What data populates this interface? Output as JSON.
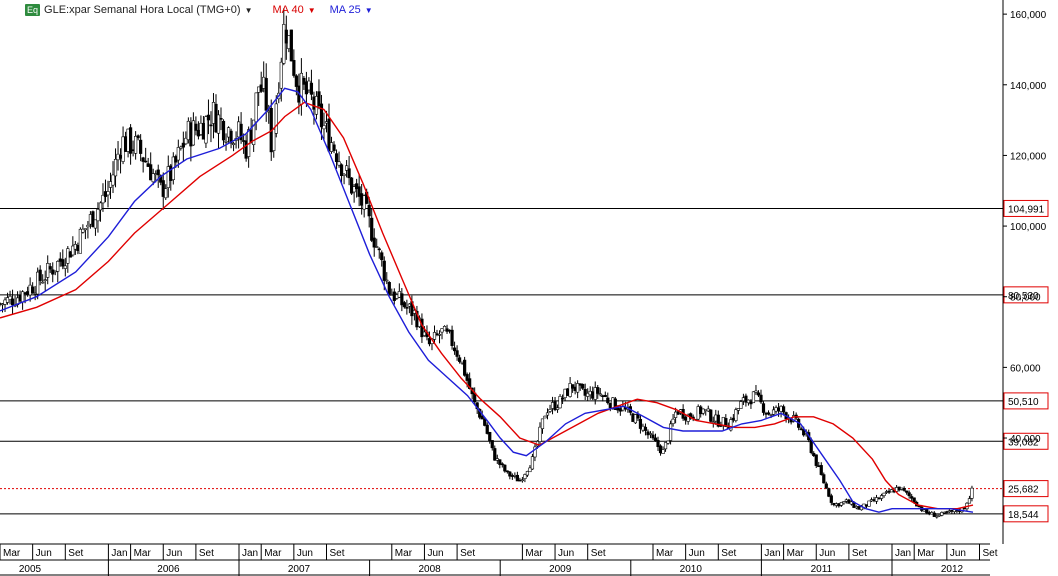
{
  "header": {
    "badge": "Eq",
    "symbol_label": "GLE:xpar Semanal Hora Local (TMG+0)",
    "ma40_label": "MA 40",
    "ma25_label": "MA 25",
    "dropdown_glyph": "▼"
  },
  "colors": {
    "price": "#000000",
    "ma40": "#e00000",
    "ma25": "#1e1ed8",
    "level_box": "#e00000",
    "badge": "#2e8b3e"
  },
  "chart_data": {
    "type": "line",
    "chart_style": "candlestick",
    "title": "GLE:xpar Semanal Hora Local (TMG+0)",
    "ylim": [
      10,
      164
    ],
    "y_ticks": [
      {
        "value": 160,
        "label": "160,000"
      },
      {
        "value": 140,
        "label": "140,000"
      },
      {
        "value": 120,
        "label": "120,000"
      },
      {
        "value": 100,
        "label": "100,000"
      },
      {
        "value": 80,
        "label": "80,000"
      },
      {
        "value": 60,
        "label": "60,000"
      },
      {
        "value": 40,
        "label": "40,000"
      }
    ],
    "x_range": [
      2005.17,
      2012.85
    ],
    "month_labels": [
      {
        "t": 2005.17,
        "label": "Mar"
      },
      {
        "t": 2005.42,
        "label": "Jun"
      },
      {
        "t": 2005.67,
        "label": "Set"
      },
      {
        "t": 2006.0,
        "label": "Jan"
      },
      {
        "t": 2006.17,
        "label": "Mar"
      },
      {
        "t": 2006.42,
        "label": "Jun"
      },
      {
        "t": 2006.67,
        "label": "Set"
      },
      {
        "t": 2007.0,
        "label": "Jan"
      },
      {
        "t": 2007.17,
        "label": "Mar"
      },
      {
        "t": 2007.42,
        "label": "Jun"
      },
      {
        "t": 2007.67,
        "label": "Set"
      },
      {
        "t": 2008.17,
        "label": "Mar"
      },
      {
        "t": 2008.42,
        "label": "Jun"
      },
      {
        "t": 2008.67,
        "label": "Set"
      },
      {
        "t": 2009.17,
        "label": "Mar"
      },
      {
        "t": 2009.42,
        "label": "Jun"
      },
      {
        "t": 2009.67,
        "label": "Set"
      },
      {
        "t": 2010.17,
        "label": "Mar"
      },
      {
        "t": 2010.42,
        "label": "Jun"
      },
      {
        "t": 2010.67,
        "label": "Set"
      },
      {
        "t": 2011.0,
        "label": "Jan"
      },
      {
        "t": 2011.17,
        "label": "Mar"
      },
      {
        "t": 2011.42,
        "label": "Jun"
      },
      {
        "t": 2011.67,
        "label": "Set"
      },
      {
        "t": 2012.0,
        "label": "Jan"
      },
      {
        "t": 2012.17,
        "label": "Mar"
      },
      {
        "t": 2012.42,
        "label": "Jun"
      },
      {
        "t": 2012.67,
        "label": "Set"
      }
    ],
    "year_labels": [
      {
        "t": 2005.2,
        "label": "2005"
      },
      {
        "t": 2006.0,
        "label": "2006"
      },
      {
        "t": 2007.0,
        "label": "2007"
      },
      {
        "t": 2008.0,
        "label": "2008"
      },
      {
        "t": 2009.0,
        "label": "2009"
      },
      {
        "t": 2010.0,
        "label": "2010"
      },
      {
        "t": 2011.0,
        "label": "2011"
      },
      {
        "t": 2012.0,
        "label": "2012"
      }
    ],
    "levels": [
      {
        "value": 104.991,
        "label": "104,991",
        "style": "solid"
      },
      {
        "value": 80.53,
        "label": "80,530",
        "style": "solid"
      },
      {
        "value": 50.51,
        "label": "50,510",
        "style": "solid"
      },
      {
        "value": 39.082,
        "label": "39,082",
        "style": "solid"
      },
      {
        "value": 25.682,
        "label": "25,682",
        "style": "dotted",
        "color": "#e00000"
      },
      {
        "value": 18.544,
        "label": "18,544",
        "style": "solid"
      }
    ],
    "series": [
      {
        "name": "GLE:xpar",
        "t": [
          2005.17,
          2005.3,
          2005.45,
          2005.6,
          2005.75,
          2005.9,
          2006.0,
          2006.1,
          2006.2,
          2006.3,
          2006.4,
          2006.5,
          2006.6,
          2006.7,
          2006.8,
          2006.9,
          2007.0,
          2007.05,
          2007.1,
          2007.15,
          2007.2,
          2007.25,
          2007.3,
          2007.35,
          2007.45,
          2007.55,
          2007.65,
          2007.75,
          2007.85,
          2007.95,
          2008.05,
          2008.15,
          2008.25,
          2008.35,
          2008.45,
          2008.55,
          2008.62,
          2008.7,
          2008.8,
          2008.88,
          2008.95,
          2009.05,
          2009.15,
          2009.25,
          2009.35,
          2009.45,
          2009.55,
          2009.65,
          2009.75,
          2009.85,
          2009.95,
          2010.05,
          2010.15,
          2010.25,
          2010.35,
          2010.45,
          2010.55,
          2010.65,
          2010.75,
          2010.85,
          2010.95,
          2011.05,
          2011.15,
          2011.25,
          2011.35,
          2011.45,
          2011.55,
          2011.65,
          2011.75,
          2011.85,
          2011.95,
          2012.05,
          2012.15,
          2012.25,
          2012.35,
          2012.45,
          2012.55,
          2012.62
        ],
        "values": [
          78,
          80,
          84,
          89,
          95,
          104,
          110,
          124,
          123,
          118,
          110,
          116,
          126,
          128,
          132,
          128,
          126,
          122,
          128,
          140,
          137,
          123,
          141,
          158,
          140,
          136,
          128,
          121,
          112,
          106,
          95,
          82,
          78,
          75,
          66,
          70,
          68,
          62,
          50,
          44,
          35,
          30,
          28,
          34,
          48,
          50,
          55,
          52,
          53,
          50,
          48,
          45,
          40,
          36,
          48,
          46,
          48,
          45,
          44,
          50,
          52,
          47,
          48,
          45,
          40,
          30,
          21,
          22,
          20,
          22,
          24,
          26,
          23,
          19,
          18,
          19,
          20,
          25.7
        ]
      },
      {
        "name": "MA 40",
        "t": [
          2005.17,
          2005.45,
          2005.75,
          2006.0,
          2006.2,
          2006.45,
          2006.7,
          2006.95,
          2007.1,
          2007.25,
          2007.35,
          2007.5,
          2007.65,
          2007.8,
          2007.95,
          2008.1,
          2008.25,
          2008.4,
          2008.55,
          2008.7,
          2008.85,
          2009.0,
          2009.15,
          2009.3,
          2009.45,
          2009.6,
          2009.75,
          2009.9,
          2010.05,
          2010.2,
          2010.35,
          2010.5,
          2010.65,
          2010.8,
          2010.95,
          2011.1,
          2011.25,
          2011.4,
          2011.55,
          2011.7,
          2011.85,
          2011.95,
          2012.05,
          2012.2,
          2012.35,
          2012.5,
          2012.62
        ],
        "values": [
          74,
          77,
          82,
          90,
          98,
          106,
          114,
          120,
          124,
          127,
          131,
          135,
          133,
          125,
          112,
          98,
          85,
          72,
          64,
          57,
          51,
          46,
          40,
          38,
          41,
          44,
          47,
          49,
          51,
          50,
          48,
          45,
          44,
          43,
          43,
          44,
          46,
          46,
          44,
          40,
          34,
          28,
          24,
          21,
          20,
          20,
          21
        ]
      },
      {
        "name": "MA 25",
        "t": [
          2005.17,
          2005.45,
          2005.75,
          2006.0,
          2006.2,
          2006.4,
          2006.6,
          2006.85,
          2007.05,
          2007.2,
          2007.35,
          2007.45,
          2007.55,
          2007.7,
          2007.85,
          2008.0,
          2008.15,
          2008.3,
          2008.45,
          2008.6,
          2008.75,
          2008.9,
          2009.0,
          2009.1,
          2009.2,
          2009.35,
          2009.5,
          2009.65,
          2009.8,
          2009.95,
          2010.1,
          2010.25,
          2010.4,
          2010.55,
          2010.7,
          2010.85,
          2011.0,
          2011.15,
          2011.3,
          2011.45,
          2011.6,
          2011.7,
          2011.8,
          2011.9,
          2012.0,
          2012.15,
          2012.3,
          2012.45,
          2012.62
        ],
        "values": [
          76,
          80,
          87,
          97,
          107,
          114,
          119,
          122,
          126,
          132,
          139,
          138,
          133,
          120,
          106,
          92,
          80,
          70,
          62,
          57,
          52,
          45,
          40,
          36,
          35,
          39,
          44,
          47,
          48,
          49,
          46,
          43,
          42,
          42,
          42,
          44,
          45,
          47,
          44,
          36,
          28,
          22,
          20,
          19,
          20,
          20,
          20,
          20,
          19
        ]
      }
    ]
  }
}
